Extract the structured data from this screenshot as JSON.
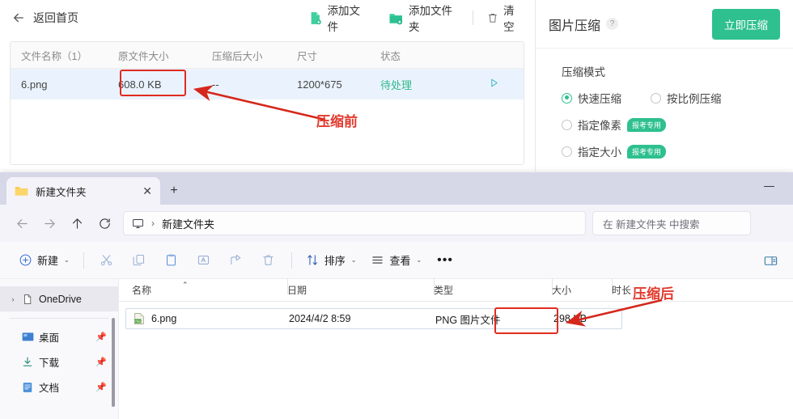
{
  "compressor": {
    "back_label": "返回首页",
    "actions": [
      {
        "label": "添加文件",
        "icon": "add-file-icon"
      },
      {
        "label": "添加文件夹",
        "icon": "add-folder-icon"
      },
      {
        "label": "清空",
        "icon": "trash-icon"
      }
    ],
    "table": {
      "columns": [
        "文件名称（1）",
        "原文件大小",
        "压缩后大小",
        "尺寸",
        "状态",
        ""
      ],
      "rows": [
        {
          "name": "6.png",
          "original_size": "608.0 KB",
          "compressed_size": "--",
          "dimensions": "1200*675",
          "status": "待处理",
          "action_icon": "play-icon"
        }
      ]
    },
    "panel": {
      "title": "图片压缩",
      "help_icon": "?",
      "compress_button": "立即压缩",
      "section_title": "压缩模式",
      "options": [
        {
          "label": "快速压缩",
          "selected": true,
          "badge": ""
        },
        {
          "label": "按比例压缩",
          "selected": false,
          "badge": ""
        },
        {
          "label": "指定像素",
          "selected": false,
          "badge": "报考专用"
        },
        {
          "label": "指定大小",
          "selected": false,
          "badge": "报考专用"
        }
      ]
    }
  },
  "explorer": {
    "tab": {
      "title": "新建文件夹",
      "close": "✕",
      "new_tab": "+"
    },
    "window_controls": {
      "minimize": "—"
    },
    "address": {
      "breadcrumb_sep": "›",
      "path": "新建文件夹"
    },
    "search": {
      "placeholder": "在 新建文件夹 中搜索"
    },
    "command_bar": {
      "new_label": "新建",
      "sort_label": "排序",
      "view_label": "查看",
      "more_label": "•••",
      "caret": "⌄",
      "icons": [
        "cut-icon",
        "copy-icon",
        "paste-icon",
        "rename-icon",
        "share-icon",
        "delete-icon"
      ]
    },
    "sidebar": [
      {
        "label": "OneDrive",
        "icon": "onedrive-icon",
        "chevron": "›",
        "selected": true,
        "pinned": false
      },
      {
        "label": "桌面",
        "icon": "desktop-icon",
        "chevron": "",
        "selected": false,
        "pinned": true
      },
      {
        "label": "下载",
        "icon": "downloads-icon",
        "chevron": "",
        "selected": false,
        "pinned": true
      },
      {
        "label": "文档",
        "icon": "documents-icon",
        "chevron": "",
        "selected": false,
        "pinned": true
      }
    ],
    "list": {
      "columns": [
        "名称",
        "日期",
        "类型",
        "大小",
        "时长"
      ],
      "rows": [
        {
          "name": "6.png",
          "date": "2024/4/2 8:59",
          "type": "PNG 图片文件",
          "size": "298 KB",
          "duration": ""
        }
      ]
    }
  },
  "annotations": {
    "before_label": "压缩前",
    "after_label": "压缩后",
    "highlight_color": "#e02b20",
    "text_color": "#e23a2e"
  }
}
